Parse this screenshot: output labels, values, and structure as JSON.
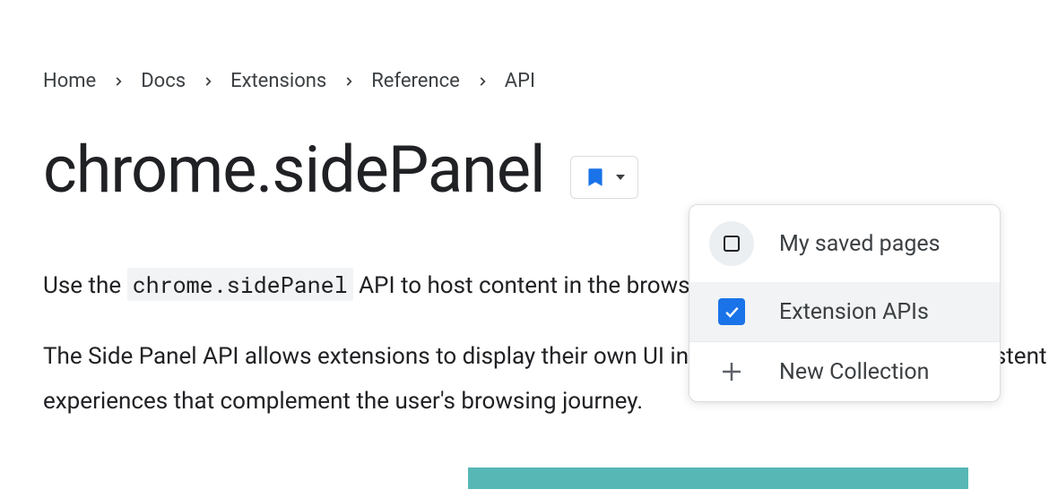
{
  "breadcrumb": {
    "items": [
      {
        "label": "Home"
      },
      {
        "label": "Docs"
      },
      {
        "label": "Extensions"
      },
      {
        "label": "Reference"
      },
      {
        "label": "API"
      }
    ]
  },
  "page": {
    "title": "chrome.sidePanel",
    "code_token": "chrome.sidePanel",
    "intro_part1": "Use the ",
    "intro_part2": " API to host content in the browser's side panel alongside the",
    "para2": "The Side Panel API allows extensions to display their own UI in the side panel, enabling persistent experiences that complement the user's browsing journey."
  },
  "bookmark_menu": {
    "items": [
      {
        "label": "My saved pages",
        "checked": false
      },
      {
        "label": "Extension APIs",
        "checked": true
      },
      {
        "label": "New Collection",
        "checked": false
      }
    ]
  }
}
